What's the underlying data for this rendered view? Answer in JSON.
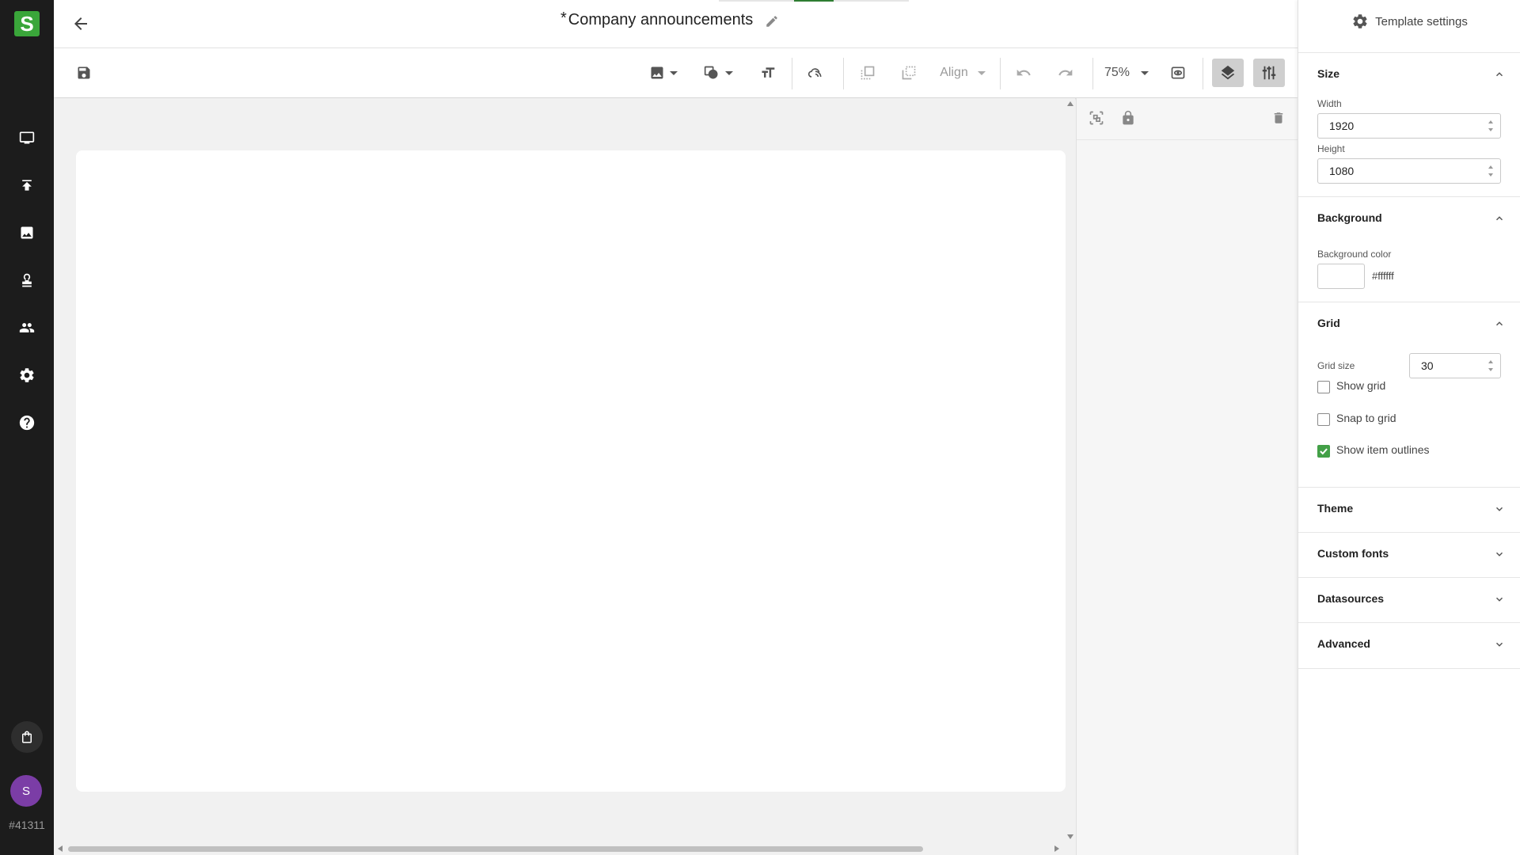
{
  "app": {
    "build_id": "#41311",
    "user_initial": "S",
    "logo_letter": "S",
    "accent_color": "#43a047"
  },
  "rail": {
    "items": [
      {
        "icon": "display-icon"
      },
      {
        "icon": "upload-icon"
      },
      {
        "icon": "image-icon"
      },
      {
        "icon": "stamp-icon"
      },
      {
        "icon": "people-icon"
      },
      {
        "icon": "gear-icon"
      },
      {
        "icon": "help-icon"
      }
    ],
    "bottom": [
      {
        "icon": "shopping-bag-icon"
      }
    ]
  },
  "header": {
    "modified_marker": "*",
    "title": "Company announcements"
  },
  "toolbar": {
    "align_label": "Align",
    "zoom_label": "75%"
  },
  "settings": {
    "title": "Template settings",
    "size": {
      "title": "Size",
      "width_label": "Width",
      "width_value": "1920",
      "height_label": "Height",
      "height_value": "1080"
    },
    "background": {
      "title": "Background",
      "color_label": "Background color",
      "color_value": "#ffffff"
    },
    "grid": {
      "title": "Grid",
      "size_label": "Grid size",
      "size_value": "30",
      "show_grid_label": "Show grid",
      "show_grid": false,
      "snap_label": "Snap to grid",
      "snap": false,
      "outlines_label": "Show item outlines",
      "outlines": true
    },
    "collapsed_sections": [
      "Theme",
      "Custom fonts",
      "Datasources",
      "Advanced"
    ]
  }
}
